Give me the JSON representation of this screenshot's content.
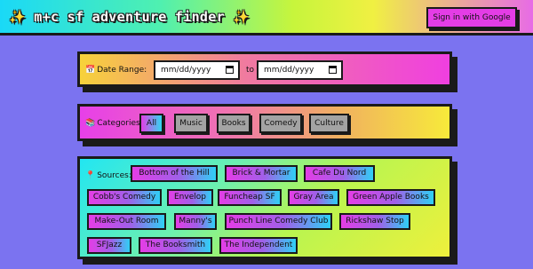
{
  "header": {
    "title": "✨ m+c sf adventure finder ✨",
    "signin_label": "Sign in with Google"
  },
  "date_range": {
    "icon": "calendar-icon",
    "label": "Date Range:",
    "start_placeholder": "mm/dd/yyyy",
    "end_placeholder": "mm/dd/yyyy",
    "separator": "to"
  },
  "categories": {
    "icon": "books-icon",
    "label": "Categories:",
    "selected": "All",
    "items": [
      "All",
      "Music",
      "Books",
      "Comedy",
      "Culture"
    ]
  },
  "sources": {
    "icon": "pin-icon",
    "label": "Sources:",
    "items": [
      "Bottom of the Hill",
      "Brick & Mortar",
      "Cafe Du Nord",
      "Cobb's Comedy",
      "Envelop",
      "Funcheap SF",
      "Gray Area",
      "Green Apple Books",
      "Make-Out Room",
      "Manny's",
      "Punch Line Comedy Club",
      "Rickshaw Stop",
      "SFJazz",
      "The Booksmith",
      "The Independent"
    ]
  },
  "colors": {
    "page_bg": "#7b73f0",
    "accent_magenta": "#e43de6",
    "accent_cyan": "#2fd8f0",
    "inactive_button": "#a3a3a3",
    "border": "#1a1a1a"
  }
}
